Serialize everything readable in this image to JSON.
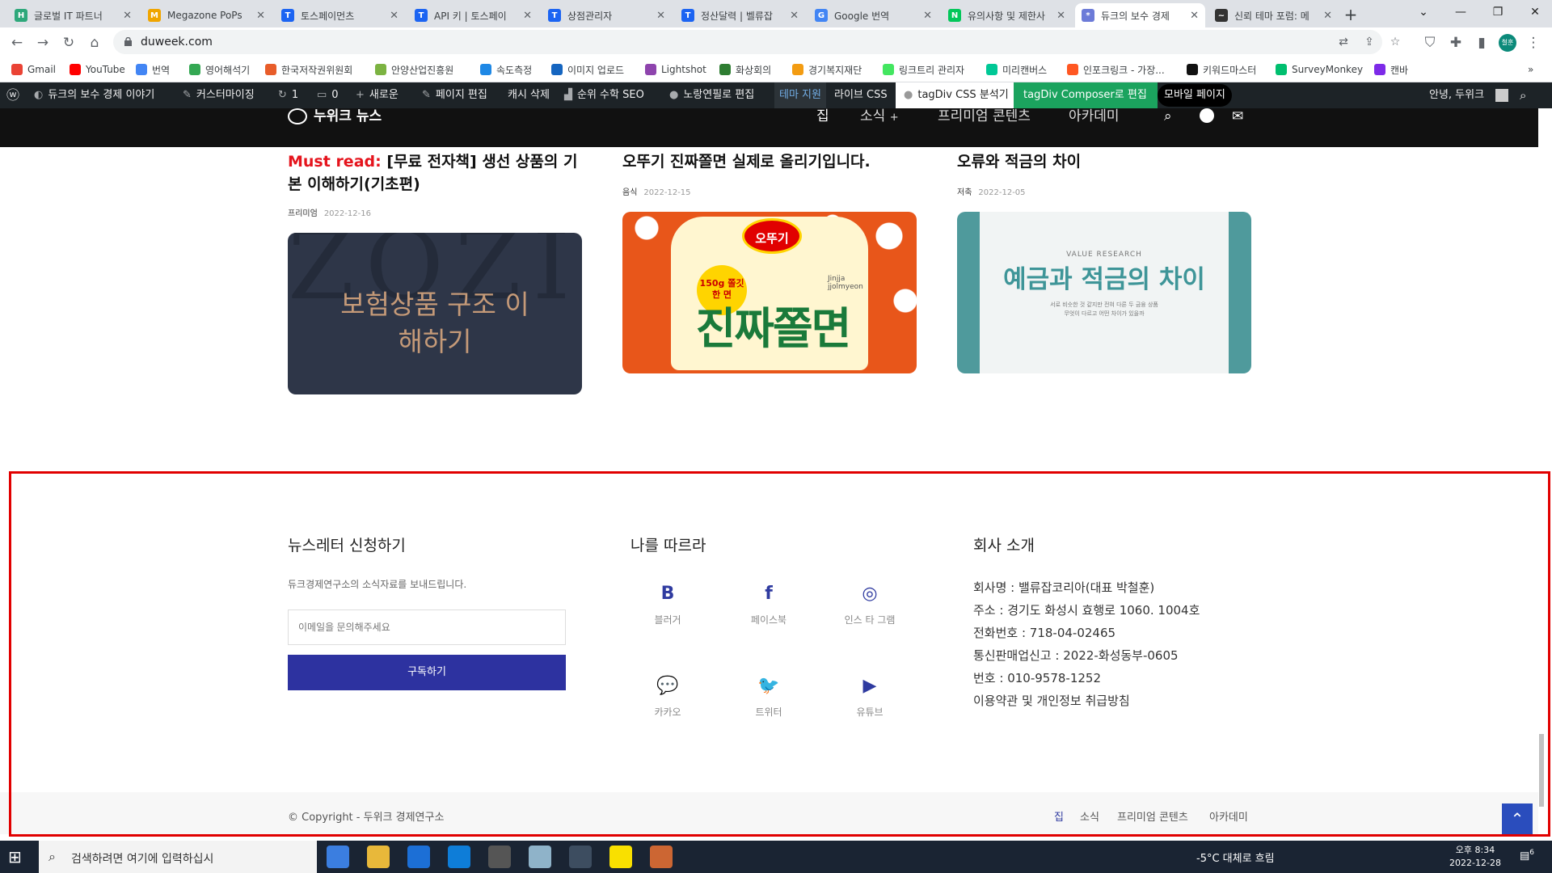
{
  "browser": {
    "tabs": [
      {
        "title": "글로벌 IT 파트너",
        "icon": "H",
        "color": "#2ea87b"
      },
      {
        "title": "Megazone PoPs",
        "icon": "M",
        "color": "#f0a500"
      },
      {
        "title": "토스페이먼츠",
        "icon": "T",
        "color": "#1c64f2"
      },
      {
        "title": "API 키 | 토스페이",
        "icon": "T",
        "color": "#1c64f2"
      },
      {
        "title": "상점관리자",
        "icon": "T",
        "color": "#1c64f2"
      },
      {
        "title": "정산달력 | 벨류잡",
        "icon": "T",
        "color": "#1c64f2"
      },
      {
        "title": "Google 번역",
        "icon": "G",
        "color": "#4285f4"
      },
      {
        "title": "유의사항 및 제한사",
        "icon": "N",
        "color": "#03c75a"
      },
      {
        "title": "듀크의 보수 경제",
        "icon": "*",
        "color": "#6c7bd8"
      },
      {
        "title": "신뢰 테마 포럼: 메",
        "icon": "~",
        "color": "#333333"
      }
    ],
    "url": "duweek.com",
    "profile_initial": "철훈"
  },
  "bookmarks": [
    {
      "label": "Gmail",
      "color": "#ea4335"
    },
    {
      "label": "YouTube",
      "color": "#ff0000"
    },
    {
      "label": "번역",
      "color": "#4285f4"
    },
    {
      "label": "영어해석기",
      "color": "#34a853"
    },
    {
      "label": "한국저작권위원회",
      "color": "#e85d2a"
    },
    {
      "label": "안양산업진흥원",
      "color": "#7cb342"
    },
    {
      "label": "속도측정",
      "color": "#1e88e5"
    },
    {
      "label": "이미지 업로드",
      "color": "#1565c0"
    },
    {
      "label": "Lightshot",
      "color": "#8e44ad"
    },
    {
      "label": "화상회의",
      "color": "#2e7d32"
    },
    {
      "label": "경기복지재단",
      "color": "#f39c12"
    },
    {
      "label": "링크트리 관리자",
      "color": "#43e660"
    },
    {
      "label": "미리캔버스",
      "color": "#00c896"
    },
    {
      "label": "인포크링크 - 가장...",
      "color": "#ff5722"
    },
    {
      "label": "키워드마스터",
      "color": "#111111"
    },
    {
      "label": "SurveyMonkey",
      "color": "#00bf6f"
    },
    {
      "label": "캔바",
      "color": "#7d2ae8"
    }
  ],
  "wpbar": {
    "site": "듀크의 보수 경제 이야기",
    "customize": "커스터마이징",
    "updates": "1",
    "comments": "0",
    "new": "새로운",
    "edit_page": "페이지 편집",
    "cache": "캐시 삭제",
    "seo": "순위 수학 SEO",
    "portfolio": "노랑연필로 편집",
    "theme_support": "테마 지원",
    "live_css": "라이브 CSS",
    "css_analyzer": "tagDiv CSS 분석기",
    "composer": "tagDiv Composer로 편집",
    "mobile": "모바일 페이지",
    "greeting": "안녕, 두위크"
  },
  "site": {
    "logo": "누위크 뉴스",
    "menu": [
      "집",
      "소식",
      "프리미엄 콘텐츠",
      "아카데미"
    ]
  },
  "cards": [
    {
      "prefix": "Must read:",
      "title": "[무료 전자책] 생선 상품의 기본 이해하기(기초편)",
      "category": "프리미엄",
      "date": "2022-12-16",
      "thumb_text": "보험상품 구조 이해하기",
      "thumb_bg": "ZOZI SINE"
    },
    {
      "prefix": "",
      "title": "오뚜기 진짜쫄면 실제로 올리기입니다.",
      "category": "음식",
      "date": "2022-12-15",
      "thumb_text": "진짜쫄면",
      "thumb_brand": "오뚜기",
      "thumb_badge": "150g 쫄깃한 면",
      "thumb_sub": "Jinjja jjolmyeon"
    },
    {
      "prefix": "",
      "title": "오류와 적금의 차이",
      "category": "저축",
      "date": "2022-12-05",
      "thumb_text": "예금과 적금의 차이",
      "thumb_kicker": "VALUE RESEARCH",
      "thumb_sub1": "서로 비슷한 것 같지만 전혀 다른 두 금융 상품",
      "thumb_sub2": "무엇이 다르고 어떤 차이가 있을까"
    }
  ],
  "footer": {
    "newsletter_title": "뉴스레터 신청하기",
    "newsletter_desc": "듀크경제연구소의 소식자료를 보내드립니다.",
    "email_placeholder": "이메일을 문의해주세요",
    "subscribe": "구독하기",
    "follow_title": "나를 따르라",
    "socials": [
      {
        "label": "블러거",
        "icon": "blogger-icon",
        "glyph": "B"
      },
      {
        "label": "페이스북",
        "icon": "facebook-icon",
        "glyph": "f"
      },
      {
        "label": "인스 타 그램",
        "icon": "instagram-icon",
        "glyph": "◎"
      },
      {
        "label": "카카오",
        "icon": "kakao-icon",
        "glyph": "💬"
      },
      {
        "label": "트위터",
        "icon": "twitter-icon",
        "glyph": "🐦"
      },
      {
        "label": "유튜브",
        "icon": "youtube-icon",
        "glyph": "▶"
      }
    ],
    "about_title": "회사 소개",
    "about_lines": [
      "회사명 : 밸류잡코리아(대표 박철훈)",
      "주소 : 경기도 화성시 효행로 1060. 1004호",
      "전화번호 : 718-04-02465",
      "통신판매업신고 : 2022-화성동부-0605",
      "번호 : 010-9578-1252",
      "이용약관 및 개인정보 취급방침"
    ],
    "copyright": "© Copyright - 두위크 경제연구소",
    "bottom_menu": [
      "집",
      "소식",
      "프리미엄 콘텐츠",
      "아카데미"
    ]
  },
  "taskbar": {
    "search_placeholder": "검색하려면 여기에 입력하십시",
    "weather": "-5°C 대체로 흐림",
    "time": "오후 8:34",
    "date": "2022-12-28",
    "notifications": "6"
  }
}
